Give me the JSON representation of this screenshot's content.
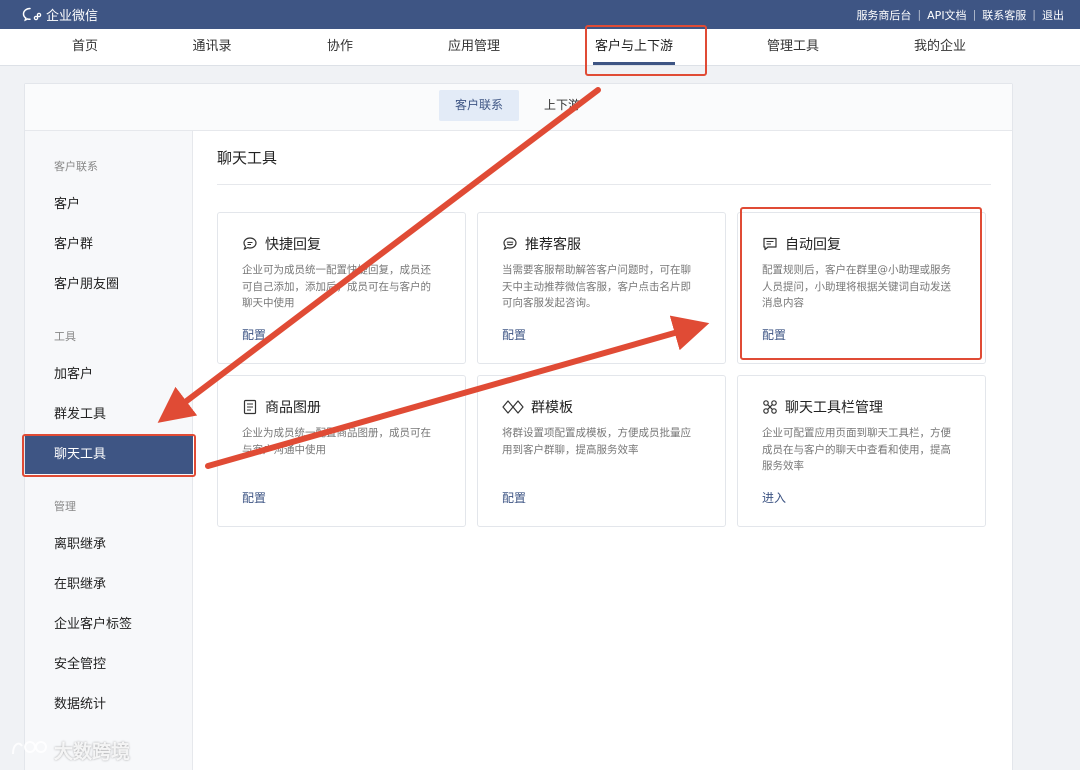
{
  "topbar": {
    "brand": "企业微信",
    "links": [
      "服务商后台",
      "API文档",
      "联系客服",
      "退出"
    ]
  },
  "nav": {
    "items": [
      "首页",
      "通讯录",
      "协作",
      "应用管理",
      "客户与上下游",
      "管理工具",
      "我的企业"
    ],
    "active_index": 4
  },
  "subtabs": {
    "active": "客户联系",
    "other": "上下游"
  },
  "sidebar": {
    "group_customer": "客户联系",
    "items_customer": [
      "客户",
      "客户群",
      "客户朋友圈"
    ],
    "group_tools": "工具",
    "items_tools": [
      "加客户",
      "群发工具",
      "聊天工具"
    ],
    "group_manage": "管理",
    "items_manage": [
      "离职继承",
      "在职继承",
      "企业客户标签",
      "安全管控",
      "数据统计"
    ],
    "active_item": "聊天工具"
  },
  "content": {
    "title": "聊天工具",
    "cards": [
      {
        "title": "快捷回复",
        "icon": "chat-bubble-icon",
        "desc": "企业可为成员统一配置快捷回复，成员还可自己添加，添加后，成员可在与客户的聊天中使用",
        "link": "配置"
      },
      {
        "title": "推荐客服",
        "icon": "service-bubble-icon",
        "desc": "当需要客服帮助解答客户问题时，可在聊天中主动推荐微信客服，客户点击名片即可向客服发起咨询。",
        "link": "配置"
      },
      {
        "title": "自动回复",
        "icon": "auto-reply-icon",
        "desc": "配置规则后，客户在群里@小助理或服务人员提问，小助理将根据关键词自动发送消息内容",
        "link": "配置"
      },
      {
        "title": "商品图册",
        "icon": "catalog-icon",
        "desc": "企业为成员统一配置商品图册，成员可在与客户沟通中使用",
        "link": "配置"
      },
      {
        "title": "群模板",
        "icon": "diamond-icon",
        "desc": "将群设置项配置成模板，方便成员批量应用到客户群聊，提高服务效率",
        "link": "配置"
      },
      {
        "title": "聊天工具栏管理",
        "icon": "toolbar-icon",
        "desc": "企业可配置应用页面到聊天工具栏，方便成员在与客户的聊天中查看和使用，提高服务效率",
        "link": "进入"
      }
    ]
  },
  "watermark": "大数跨境",
  "colors": {
    "brand": "#3e5584",
    "annotation": "#e04b35"
  }
}
